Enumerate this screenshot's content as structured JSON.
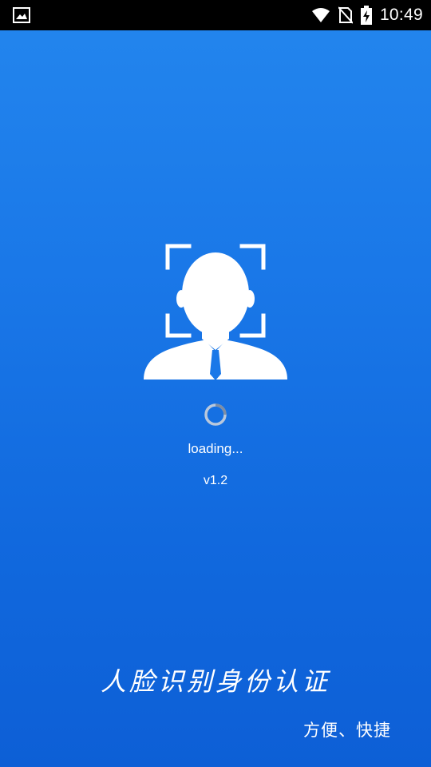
{
  "status_bar": {
    "time": "10:49",
    "icons": [
      "image-notification-icon",
      "wifi-icon",
      "no-sim-icon",
      "battery-charging-icon"
    ]
  },
  "splash": {
    "logo_icon": "face-recognition-icon",
    "loading_text": "loading...",
    "version": "v1.2",
    "slogan": "人脸识别身份认证",
    "tagline": "方便、快捷"
  },
  "colors": {
    "background_top": "#2386ee",
    "background_bottom": "#0d5fd6",
    "status_bar": "#000000",
    "text": "#ffffff"
  }
}
